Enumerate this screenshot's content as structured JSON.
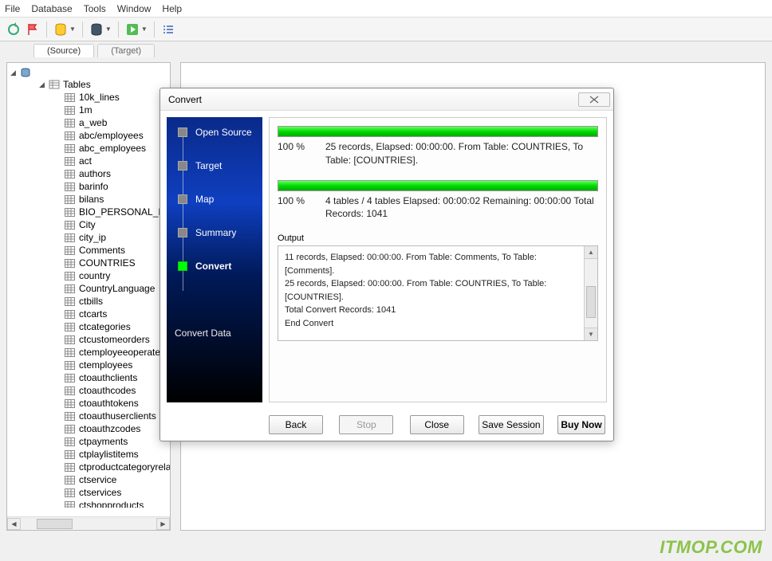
{
  "menu": {
    "items": [
      "File",
      "Database",
      "Tools",
      "Window",
      "Help"
    ]
  },
  "tabs": {
    "source": "(Source)",
    "target": "(Target)"
  },
  "tree": {
    "tables_label": "Tables",
    "items": [
      "10k_lines",
      "1m",
      "a_web",
      "abc/employees",
      "abc_employees",
      "act",
      "authors",
      "barinfo",
      "bilans",
      "BIO_PERSONAL_INF",
      "City",
      "city_ip",
      "Comments",
      "COUNTRIES",
      "country",
      "CountryLanguage",
      "ctbills",
      "ctcarts",
      "ctcategories",
      "ctcustomeorders",
      "ctemployeeoperatelog",
      "ctemployees",
      "ctoauthclients",
      "ctoauthcodes",
      "ctoauthtokens",
      "ctoauthuserclients",
      "ctoauthzcodes",
      "ctpayments",
      "ctplaylistitems",
      "ctproductcategoryrelation",
      "ctservice",
      "ctservices",
      "ctshopproducts"
    ]
  },
  "dialog": {
    "title": "Convert",
    "sidebar": {
      "steps": [
        "Open Source",
        "Target",
        "Map",
        "Summary",
        "Convert"
      ],
      "active": "Convert",
      "footer": "Convert Data"
    },
    "progress1": {
      "pct": "100 %",
      "line": "25 records,    Elapsed: 00:00:00.    From Table: COUNTRIES,    To Table: [COUNTRIES]."
    },
    "progress2": {
      "pct": "100 %",
      "line": "4 tables / 4 tables    Elapsed: 00:00:02    Remaining: 00:00:00    Total Records: 1041"
    },
    "output_label": "Output",
    "output_text": "11 records,    Elapsed: 00:00:00.    From Table: Comments,    To Table: [Comments].\n25 records,    Elapsed: 00:00:00.    From Table: COUNTRIES,    To Table: [COUNTRIES].\nTotal Convert Records: 1041\nEnd Convert",
    "buttons": {
      "back": "Back",
      "stop": "Stop",
      "close": "Close",
      "save": "Save Session",
      "buy": "Buy Now"
    }
  },
  "watermark": "ITMOP.COM"
}
